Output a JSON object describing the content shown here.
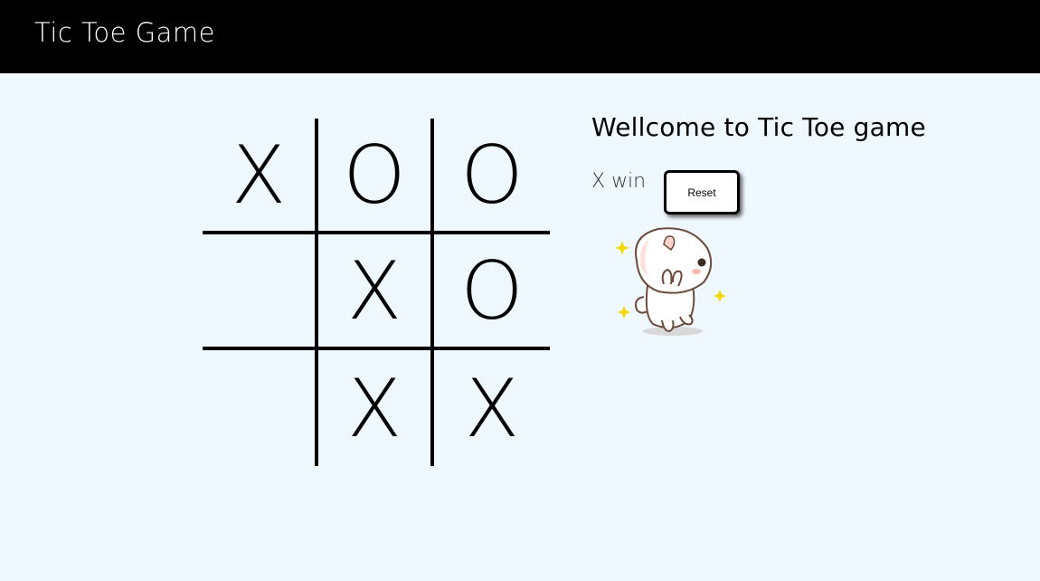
{
  "navbar": {
    "title": "Tic Toe Game"
  },
  "board": {
    "cells": [
      "X",
      "O",
      "O",
      "",
      "X",
      "O",
      "",
      "X",
      "X"
    ]
  },
  "info": {
    "welcome": "Wellcome to Tic Toe game",
    "status": "X win",
    "reset_label": "Reset"
  },
  "icons": {
    "celebration": "cat-celebration-icon"
  },
  "colors": {
    "navbar": "#000000",
    "background": "#f0f8ff"
  }
}
